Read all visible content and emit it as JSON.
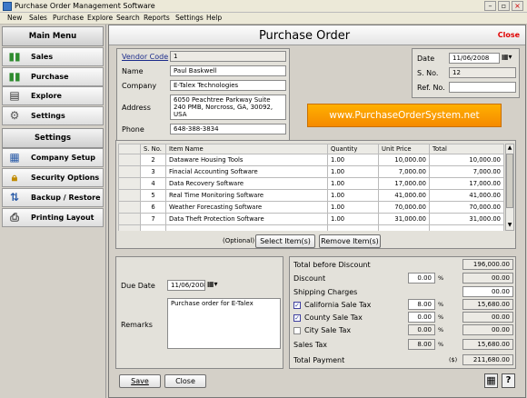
{
  "window": {
    "title": "Purchase Order Management Software"
  },
  "menu": [
    "New",
    "Sales",
    "Purchase",
    "Explore",
    "Search",
    "Reports",
    "Settings",
    "Help"
  ],
  "sidebar": {
    "main_menu_title": "Main Menu",
    "main_items": [
      {
        "label": "Sales",
        "icon": "sales-chart-icon"
      },
      {
        "label": "Purchase",
        "icon": "purchase-chart-icon"
      },
      {
        "label": "Explore",
        "icon": "explore-document-icon"
      },
      {
        "label": "Settings",
        "icon": "gear-icon"
      }
    ],
    "settings_title": "Settings",
    "settings_items": [
      {
        "label": "Company Setup",
        "icon": "company-setup-icon"
      },
      {
        "label": "Security Options",
        "icon": "lock-icon"
      },
      {
        "label": "Backup / Restore",
        "icon": "backup-icon"
      },
      {
        "label": "Printing Layout",
        "icon": "printer-icon"
      }
    ]
  },
  "header": {
    "title": "Purchase Order",
    "close_label": "Close"
  },
  "vendor": {
    "code_label": "Vendor Code",
    "code": "1",
    "name_label": "Name",
    "name": "Paul Baskwell",
    "company_label": "Company",
    "company": "E-Talex Technologies",
    "address_label": "Address",
    "address": "6050 Peachtree Parkway Suite 240 PMB, Norcross, GA, 30092, USA",
    "phone_label": "Phone",
    "phone": "648-388-3834"
  },
  "order": {
    "date_label": "Date",
    "date": "11/06/2008",
    "sno_label": "S. No.",
    "sno": "12",
    "ref_label": "Ref. No.",
    "ref": ""
  },
  "banner": "www.PurchaseOrderSystem.net",
  "items": {
    "columns": [
      "S. No.",
      "Item Name",
      "Quantity",
      "Unit Price",
      "Total"
    ],
    "rows": [
      [
        "2",
        "Dataware Housing Tools",
        "1.00",
        "10,000.00",
        "10,000.00"
      ],
      [
        "3",
        "Finacial Accounting Software",
        "1.00",
        "7,000.00",
        "7,000.00"
      ],
      [
        "4",
        "Data Recovery Software",
        "1.00",
        "17,000.00",
        "17,000.00"
      ],
      [
        "5",
        "Real Time Monitoring Software",
        "1.00",
        "41,000.00",
        "41,000.00"
      ],
      [
        "6",
        "Weather Forecasting Software",
        "1.00",
        "70,000.00",
        "70,000.00"
      ],
      [
        "7",
        "Data Theft Protection Software",
        "1.00",
        "31,000.00",
        "31,000.00"
      ]
    ],
    "optional_label": "(Optional)",
    "select_label": "Select Item(s)",
    "remove_label": "Remove Item(s)"
  },
  "due": {
    "due_label": "Due Date",
    "due_date": "11/06/2008",
    "remarks_label": "Remarks",
    "remarks": "Purchase order for E-Talex"
  },
  "summary": {
    "total_before_label": "Total before Discount",
    "total_before": "196,000.00",
    "discount_label": "Discount",
    "discount_pct": "0.00",
    "discount_amt": "00.00",
    "pct_sign": "%",
    "shipping_label": "Shipping Charges",
    "shipping": "00.00",
    "ca_label": "California Sale Tax",
    "ca_pct": "8.00",
    "ca_amt": "15,680.00",
    "county_label": "County Sale Tax",
    "county_pct": "0.00",
    "county_amt": "00.00",
    "city_label": "City Sale Tax",
    "city_pct": "0.00",
    "city_amt": "00.00",
    "sales_tax_label": "Sales Tax",
    "sales_tax_pct": "8.00",
    "sales_tax_amt": "15,680.00",
    "total_payment_label": "Total Payment",
    "currency": "($)",
    "total_payment": "211,680.00"
  },
  "footer": {
    "save_label": "Save",
    "close_label": "Close",
    "calc_icon": "calculator-icon",
    "help_icon": "help-icon"
  }
}
